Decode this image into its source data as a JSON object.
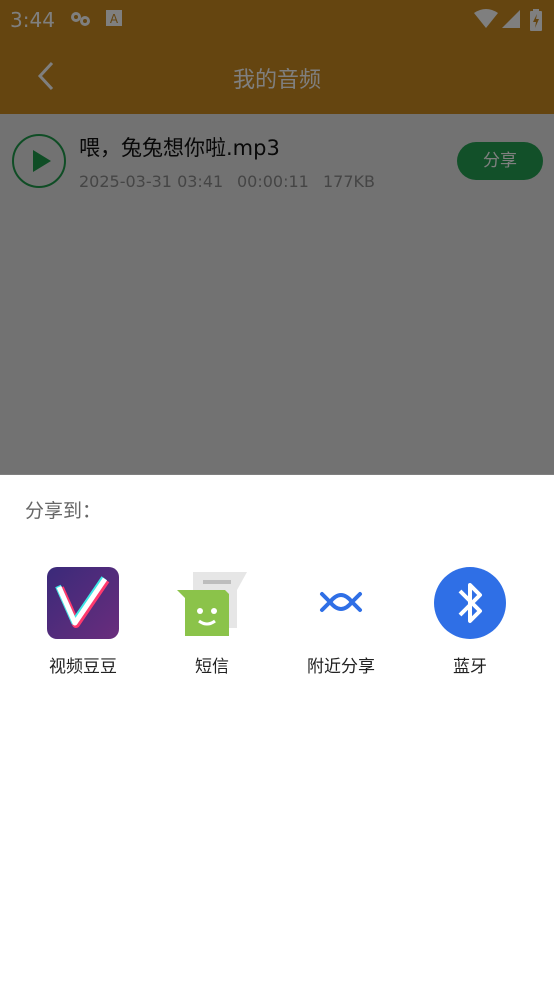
{
  "status_bar": {
    "time": "3:44"
  },
  "app_bar": {
    "title": "我的音频"
  },
  "audio_item": {
    "file_name": "喂，兔兔想你啦.mp3",
    "date": "2025-03-31 03:41",
    "duration": "00:00:11",
    "size": "177KB",
    "share_label": "分享"
  },
  "share_sheet": {
    "title": "分享到：",
    "items": [
      {
        "label": "视频豆豆",
        "icon": "video-doudou-icon"
      },
      {
        "label": "短信",
        "icon": "sms-icon"
      },
      {
        "label": "附近分享",
        "icon": "nearby-share-icon"
      },
      {
        "label": "蓝牙",
        "icon": "bluetooth-icon"
      }
    ]
  }
}
